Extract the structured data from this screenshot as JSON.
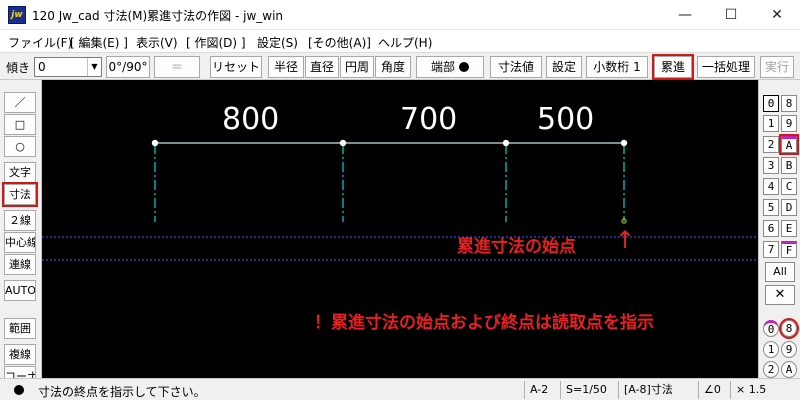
{
  "window": {
    "app_icon": "jw",
    "title": "120 Jw_cad 寸法(M)累進寸法の作図 - jw_win",
    "min_glyph": "—",
    "max_glyph": "☐",
    "close_glyph": "✕"
  },
  "menu": [
    "ファイル(F)",
    "[ 編集(E) ]",
    "表示(V)",
    "[ 作図(D) ]",
    "設定(S)",
    "[その他(A)]",
    "ヘルプ(H)"
  ],
  "toolbar": {
    "tilt_label": "傾き",
    "tilt_value": "0",
    "angle_button": "0°/90°",
    "equal_button": "＝",
    "reset_button": "リセット",
    "radius_button": "半径",
    "diameter_button": "直径",
    "circumference_button": "円周",
    "angle_mode_button": "角度",
    "endpoint_button": "端部",
    "dim_value_button": "寸法値",
    "settings_button": "設定",
    "decimal_button": "小数桁 1",
    "cumulative_button": "累進",
    "batch_button": "一括処理",
    "execute_button": "実行"
  },
  "left_tools": [
    "／",
    "□",
    "○",
    "文字",
    "寸法",
    "２線",
    "中心線",
    "連線",
    "AUTO",
    "範囲",
    "複線",
    "コーナー"
  ],
  "right_layers": {
    "groups": [
      "0",
      "1",
      "2",
      "3",
      "4",
      "5",
      "6",
      "7"
    ],
    "layers": [
      "8",
      "9",
      "A",
      "B",
      "C",
      "D",
      "E",
      "F"
    ],
    "all": "All",
    "close": "✕",
    "bottom_left": [
      "0",
      "1",
      "2"
    ],
    "bottom_right": [
      "8",
      "9",
      "A"
    ]
  },
  "canvas": {
    "dimension_labels": [
      "800",
      "700",
      "500"
    ],
    "arrow_glyph": "↑",
    "start_note": "累進寸法の始点",
    "instruction_note": "！累進寸法の始点および終点は読取点を指示"
  },
  "colors": {
    "canvas_bg": "#000000",
    "dimension_line": "#bfe8e8",
    "aux_line": "#00c8c8",
    "guide_line": "#4060ff",
    "annotation": "#e82020",
    "highlight": "#d01818"
  },
  "status": {
    "message": "寸法の終点を指示して下さい。",
    "paper": "A-2",
    "scale": "S=1/50",
    "layer": "[A-8]寸法",
    "angle": "∠0",
    "zoom": "× 1.5"
  }
}
